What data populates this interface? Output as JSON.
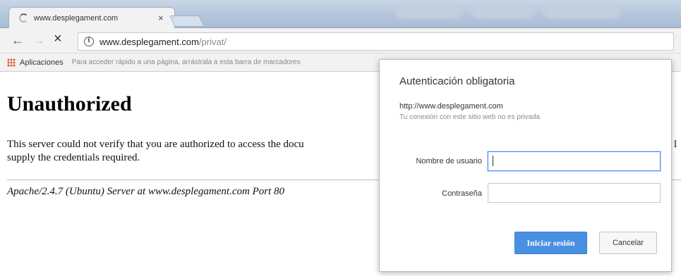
{
  "browser": {
    "tab": {
      "title": "www.desplegament.com",
      "close_glyph": "×",
      "icon": "loading-spinner-icon"
    },
    "toolbar": {
      "back_glyph": "←",
      "forward_glyph": "→",
      "stop_glyph": "×",
      "info_glyph": "i",
      "url_host": "www.desplegament.com",
      "url_path": "/privat/"
    },
    "bookmarks": {
      "apps_label": "Aplicaciones",
      "hint": "Para acceder rápido a una página, arrástrala a esta barra de marcadores"
    }
  },
  "page": {
    "heading": "Unauthorized",
    "message_line1": "This server could not verify that you are authorized to access the docu",
    "message_tail": "l",
    "message_line2": "supply the credentials required.",
    "server_signature": "Apache/2.4.7 (Ubuntu) Server at www.desplegament.com Port 80"
  },
  "auth_dialog": {
    "title": "Autenticación obligatoria",
    "origin": "http://www.desplegament.com",
    "warning": "Tu conexión con este sitio web no es privada",
    "username_label": "Nombre de usuario",
    "username_value": "",
    "password_label": "Contraseña",
    "password_value": "",
    "signin_label": "Iniciar sesión",
    "cancel_label": "Cancelar",
    "accent_color": "#4a90e2"
  }
}
